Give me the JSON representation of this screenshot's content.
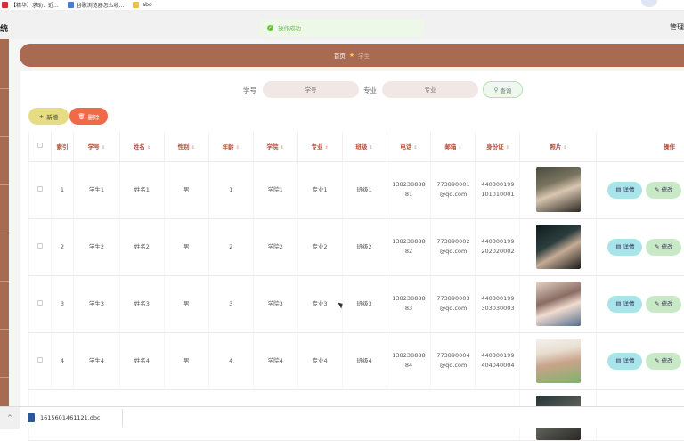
{
  "bookmarks": [
    {
      "label": "【精华】求助：近...",
      "color": "#cc3333"
    },
    {
      "label": "谷歌浏览器怎么收...",
      "color": "#4a7bd0"
    },
    {
      "label": "abo",
      "color": "#e8c14a"
    }
  ],
  "topbar": {
    "left_text": "统",
    "right_text": "管理"
  },
  "toast": {
    "icon": "check-circle-icon",
    "text": "操作成功",
    "color": "#67c23a"
  },
  "breadcrumb": {
    "home": "首页",
    "separator_icon": "star-icon",
    "current": "学生"
  },
  "search": {
    "student_no_label": "学号",
    "student_no_placeholder": "学号",
    "major_label": "专业",
    "major_placeholder": "专业",
    "query_icon": "search-icon",
    "query_label": "查询"
  },
  "toolbar": {
    "add_icon": "plus-icon",
    "add_label": "新增",
    "delete_icon": "trash-icon",
    "delete_label": "删除"
  },
  "table": {
    "headers": {
      "index": "索引",
      "student_no": "学号",
      "name": "姓名",
      "gender": "性别",
      "age": "年龄",
      "college": "学院",
      "major": "专业",
      "class": "班级",
      "phone": "电话",
      "email": "邮箱",
      "id_card": "身份证",
      "photo": "照片",
      "actions": "操作"
    },
    "detail_label": "详情",
    "edit_label": "修改",
    "rows": [
      {
        "index": "1",
        "student_no": "学生1",
        "name": "姓名1",
        "gender": "男",
        "age": "1",
        "college": "学院1",
        "major": "专业1",
        "class": "班级1",
        "phone_1": "138238888",
        "phone_2": "81",
        "email_1": "773890001",
        "email_2": "@qq.com",
        "id_1": "440300199",
        "id_2": "101010001"
      },
      {
        "index": "2",
        "student_no": "学生2",
        "name": "姓名2",
        "gender": "男",
        "age": "2",
        "college": "学院2",
        "major": "专业2",
        "class": "班级2",
        "phone_1": "138238888",
        "phone_2": "82",
        "email_1": "773890002",
        "email_2": "@qq.com",
        "id_1": "440300199",
        "id_2": "202020002"
      },
      {
        "index": "3",
        "student_no": "学生3",
        "name": "姓名3",
        "gender": "男",
        "age": "3",
        "college": "学院3",
        "major": "专业3",
        "class": "班级3",
        "phone_1": "138238888",
        "phone_2": "83",
        "email_1": "773890003",
        "email_2": "@qq.com",
        "id_1": "440300199",
        "id_2": "303030003"
      },
      {
        "index": "4",
        "student_no": "学生4",
        "name": "姓名4",
        "gender": "男",
        "age": "4",
        "college": "学院4",
        "major": "专业4",
        "class": "班级4",
        "phone_1": "138238888",
        "phone_2": "84",
        "email_1": "773890004",
        "email_2": "@qq.com",
        "id_1": "440300199",
        "id_2": "404040004"
      }
    ]
  },
  "colors": {
    "accent": "#a96a52",
    "header_text": "#b54d35",
    "delete": "#f06a48",
    "add": "#e5dc83"
  },
  "downloads": {
    "file_name": "1615601461121.doc",
    "chevron_icon": "chevron-up-icon",
    "file_icon": "word-doc-icon"
  }
}
